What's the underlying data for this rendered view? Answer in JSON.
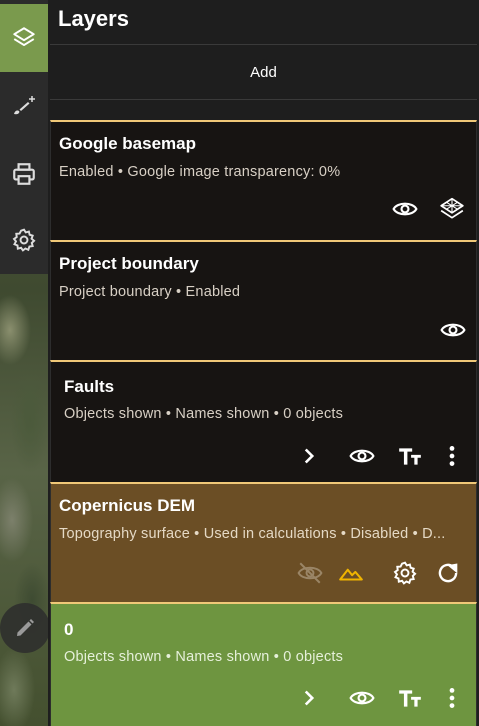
{
  "panel": {
    "title": "Layers",
    "add_label": "Add"
  },
  "sidebar": {
    "items": [
      {
        "name": "layers",
        "icon": "layers-icon",
        "active": true
      },
      {
        "name": "draw",
        "icon": "draw-add-icon",
        "active": false
      },
      {
        "name": "print",
        "icon": "print-icon",
        "active": false
      },
      {
        "name": "settings",
        "icon": "gear-icon",
        "active": false
      }
    ]
  },
  "layers": [
    {
      "title": "Google basemap",
      "subtitle": "Enabled • Google image transparency: 0%"
    },
    {
      "title": "Project boundary",
      "subtitle": "Project boundary • Enabled"
    },
    {
      "title": "Faults",
      "subtitle": "Objects shown • Names shown • 0 objects"
    },
    {
      "title": "Copernicus DEM",
      "subtitle": "Topography surface • Used in calculations • Disabled • D..."
    },
    {
      "title": "0",
      "subtitle": "Objects shown • Names shown • 0 objects"
    }
  ],
  "colors": {
    "accent_active": "#7a9a4d",
    "card_border": "#f0c878",
    "dem_background": "#6b4e25",
    "selected_background": "#6e9540"
  }
}
